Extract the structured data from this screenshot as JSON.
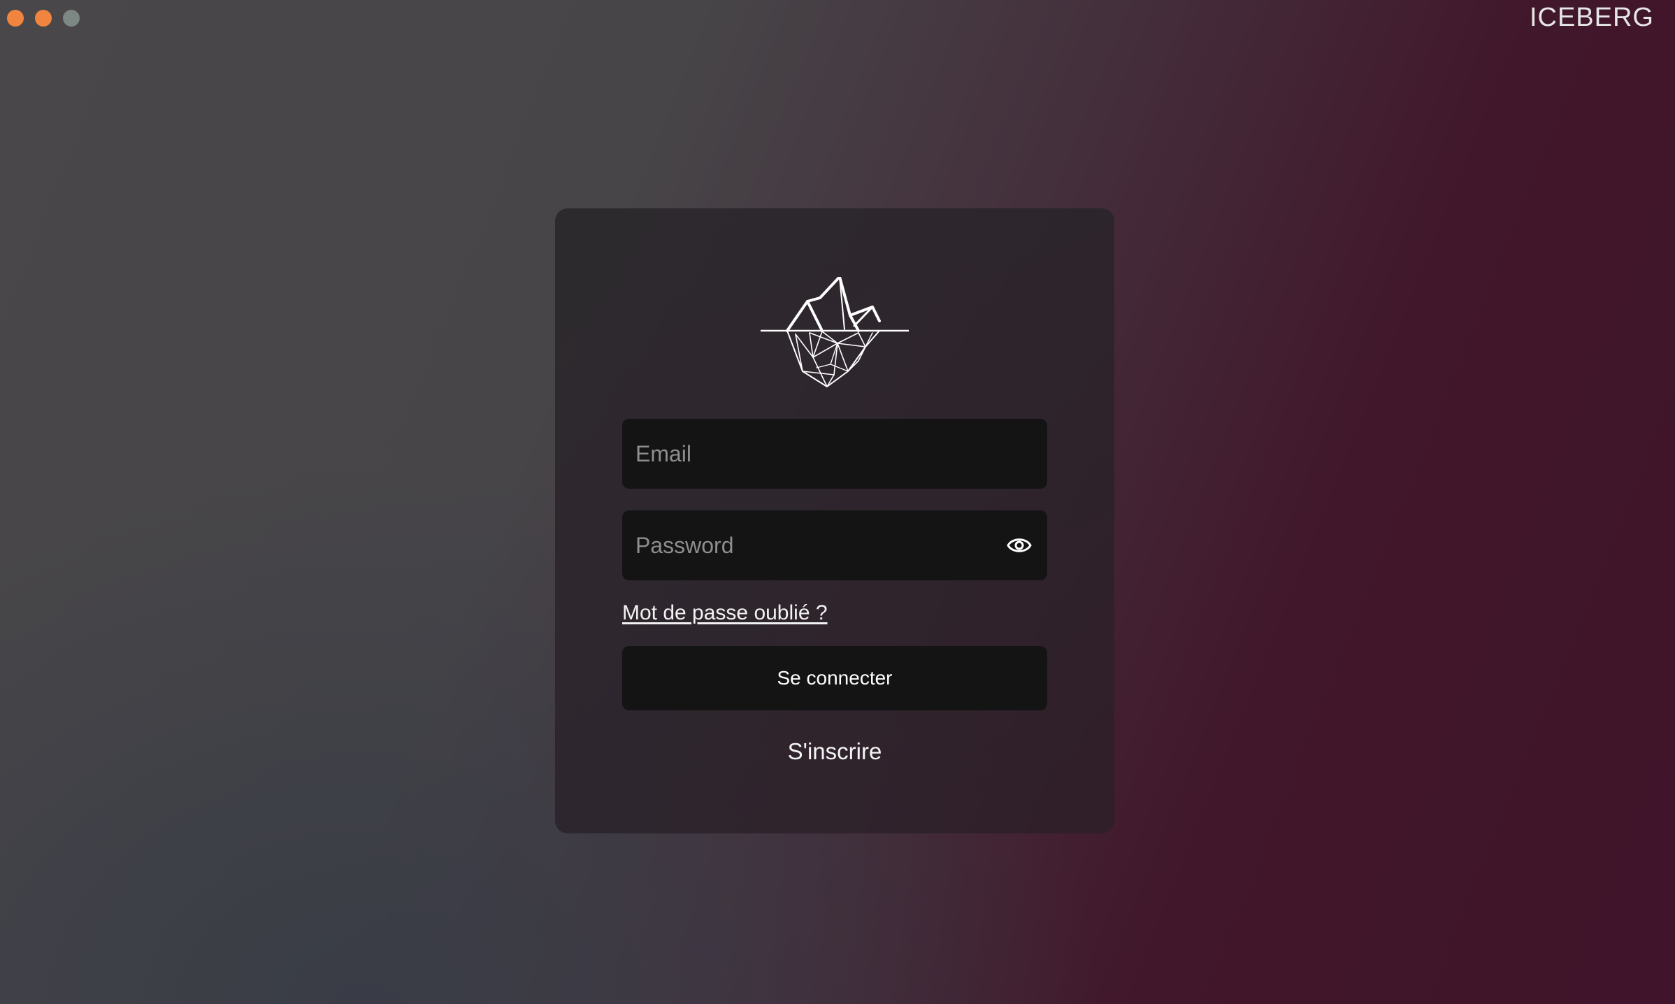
{
  "window": {
    "app_title": "ICEBERG",
    "traffic_lights": {
      "close_color": "#f18540",
      "minimize_color": "#f18540",
      "zoom_color": "#7d8783"
    }
  },
  "login_form": {
    "logo_icon": "iceberg-icon",
    "email": {
      "placeholder": "Email",
      "value": ""
    },
    "password": {
      "placeholder": "Password",
      "value": "",
      "toggle_icon": "eye-icon"
    },
    "forgot_password_label": "Mot de passe oublié ?",
    "submit_label": "Se connecter",
    "signup_label": "S'inscrire"
  }
}
